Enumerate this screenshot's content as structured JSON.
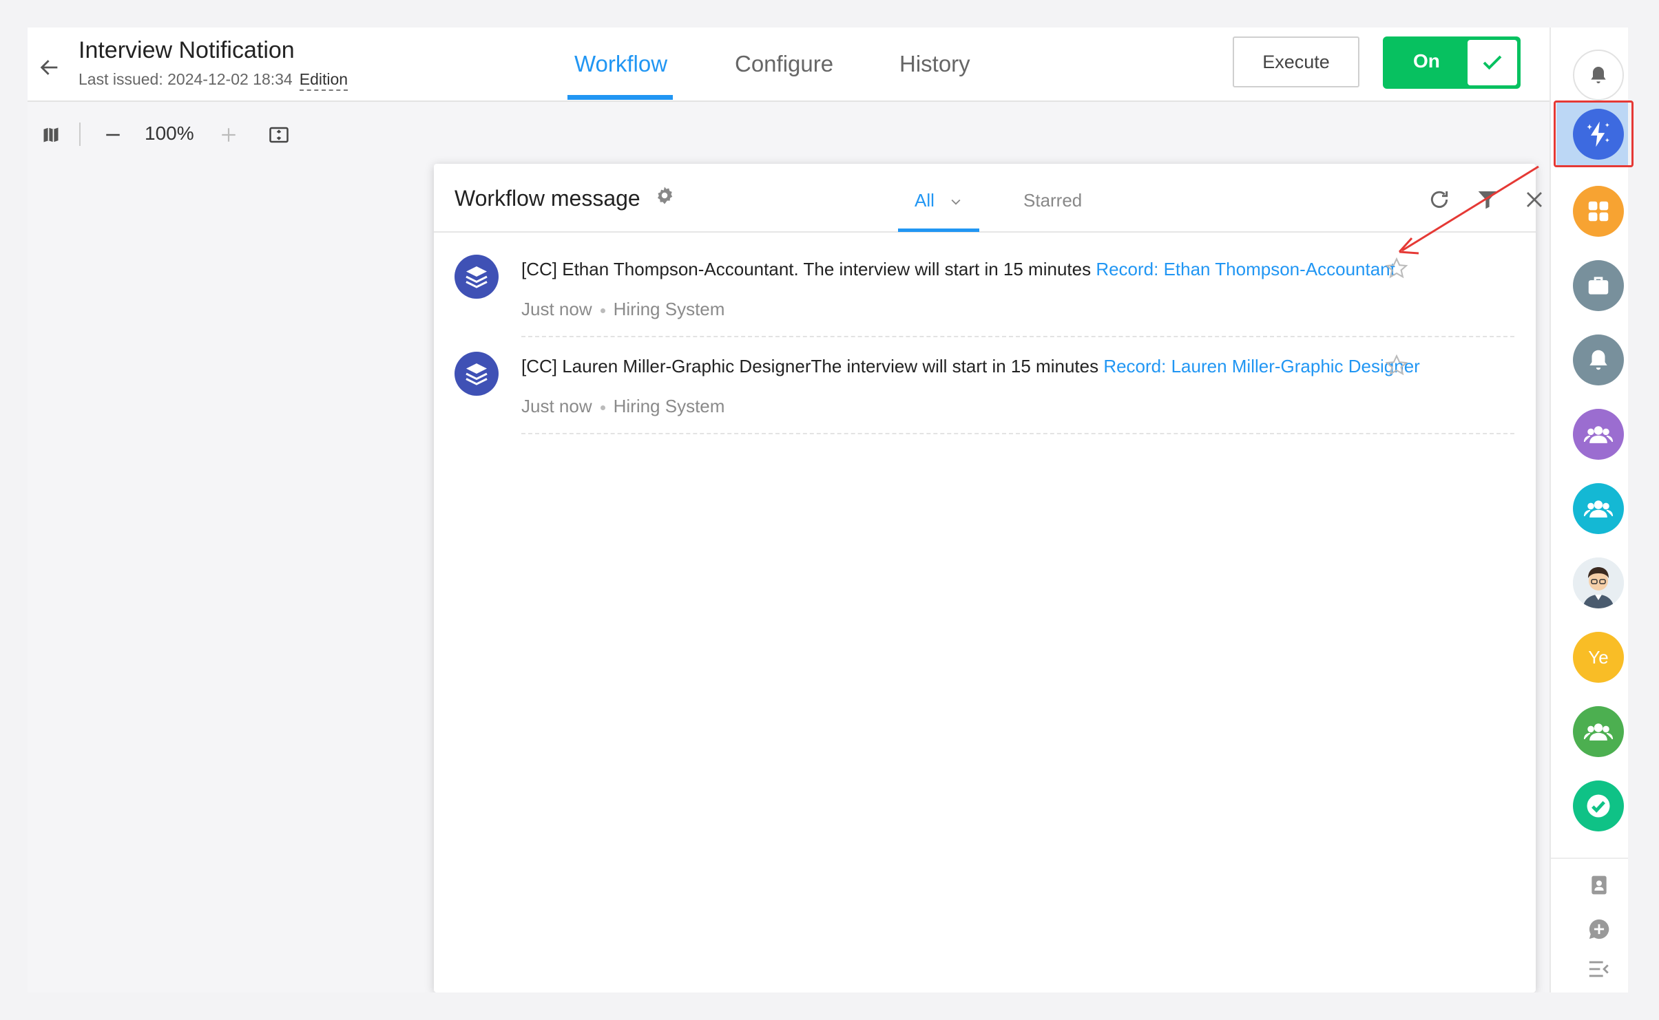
{
  "header": {
    "title": "Interview Notification",
    "last_issued": "Last issued: 2024-12-02 18:34",
    "edition": "Edition",
    "tabs": [
      {
        "label": "Workflow",
        "active": true
      },
      {
        "label": "Configure",
        "active": false
      },
      {
        "label": "History",
        "active": false
      }
    ],
    "execute_label": "Execute",
    "toggle_label": "On"
  },
  "toolbar": {
    "zoom": "100%",
    "icons": [
      "map-icon",
      "zoom-out-icon",
      "zoom-in-icon",
      "fit-screen-icon"
    ]
  },
  "panel": {
    "title": "Workflow message",
    "tabs": [
      {
        "label": "All",
        "active": true
      },
      {
        "label": "Starred",
        "active": false
      }
    ],
    "header_icons": [
      "refresh-icon",
      "filter-icon",
      "close-icon"
    ],
    "messages": [
      {
        "text": "[CC] Ethan Thompson-Accountant. The interview will start in 15 minutes ",
        "link": "Record: Ethan Thompson-Accountant",
        "time": "Just now",
        "source": "Hiring System",
        "starred": false
      },
      {
        "text": "[CC] Lauren Miller-Graphic DesignerThe interview will start in 15 minutes ",
        "link": "Record: Lauren Miller-Graphic Designer",
        "time": "Just now",
        "source": "Hiring System",
        "starred": false
      }
    ]
  },
  "sidebar": {
    "items": [
      {
        "icon": "bell-icon",
        "color": "#ffffff"
      },
      {
        "icon": "workflow-spark-icon",
        "color": "#3d6ae0",
        "active": true
      },
      {
        "icon": "apps-grid-icon",
        "color": "#f7a332"
      },
      {
        "icon": "briefcase-icon",
        "color": "#78909c"
      },
      {
        "icon": "notification-bell-icon",
        "color": "#78909c"
      },
      {
        "icon": "group-icon",
        "color": "#9b6dd0"
      },
      {
        "icon": "group-icon",
        "color": "#14b8d4"
      },
      {
        "icon": "user-avatar",
        "color": "#e8eef2"
      },
      {
        "icon": "initials-avatar",
        "color": "#f9bd26",
        "initials": "Ye"
      },
      {
        "icon": "group-icon",
        "color": "#4caf50"
      },
      {
        "icon": "check-circle-icon",
        "color": "#0fc286"
      }
    ],
    "bottom_icons": [
      "contacts-icon",
      "add-chat-icon",
      "collapse-menu-icon"
    ]
  },
  "colors": {
    "accent": "#2196f3",
    "toggle_green": "#07c160",
    "annotation_red": "#e53935"
  }
}
